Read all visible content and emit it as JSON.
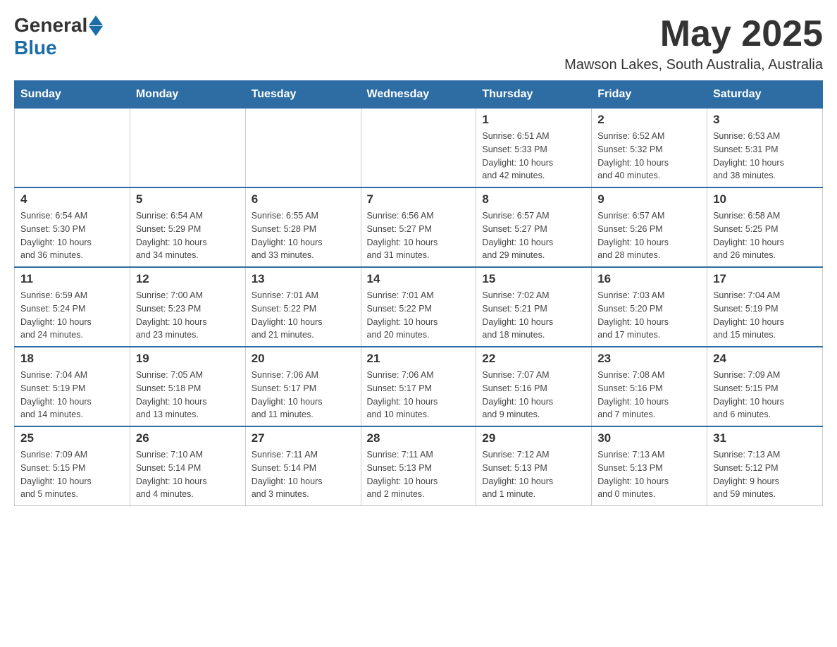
{
  "header": {
    "logo_general": "General",
    "logo_blue": "Blue",
    "month_year": "May 2025",
    "location": "Mawson Lakes, South Australia, Australia"
  },
  "weekdays": [
    "Sunday",
    "Monday",
    "Tuesday",
    "Wednesday",
    "Thursday",
    "Friday",
    "Saturday"
  ],
  "weeks": [
    [
      {
        "day": "",
        "info": ""
      },
      {
        "day": "",
        "info": ""
      },
      {
        "day": "",
        "info": ""
      },
      {
        "day": "",
        "info": ""
      },
      {
        "day": "1",
        "info": "Sunrise: 6:51 AM\nSunset: 5:33 PM\nDaylight: 10 hours\nand 42 minutes."
      },
      {
        "day": "2",
        "info": "Sunrise: 6:52 AM\nSunset: 5:32 PM\nDaylight: 10 hours\nand 40 minutes."
      },
      {
        "day": "3",
        "info": "Sunrise: 6:53 AM\nSunset: 5:31 PM\nDaylight: 10 hours\nand 38 minutes."
      }
    ],
    [
      {
        "day": "4",
        "info": "Sunrise: 6:54 AM\nSunset: 5:30 PM\nDaylight: 10 hours\nand 36 minutes."
      },
      {
        "day": "5",
        "info": "Sunrise: 6:54 AM\nSunset: 5:29 PM\nDaylight: 10 hours\nand 34 minutes."
      },
      {
        "day": "6",
        "info": "Sunrise: 6:55 AM\nSunset: 5:28 PM\nDaylight: 10 hours\nand 33 minutes."
      },
      {
        "day": "7",
        "info": "Sunrise: 6:56 AM\nSunset: 5:27 PM\nDaylight: 10 hours\nand 31 minutes."
      },
      {
        "day": "8",
        "info": "Sunrise: 6:57 AM\nSunset: 5:27 PM\nDaylight: 10 hours\nand 29 minutes."
      },
      {
        "day": "9",
        "info": "Sunrise: 6:57 AM\nSunset: 5:26 PM\nDaylight: 10 hours\nand 28 minutes."
      },
      {
        "day": "10",
        "info": "Sunrise: 6:58 AM\nSunset: 5:25 PM\nDaylight: 10 hours\nand 26 minutes."
      }
    ],
    [
      {
        "day": "11",
        "info": "Sunrise: 6:59 AM\nSunset: 5:24 PM\nDaylight: 10 hours\nand 24 minutes."
      },
      {
        "day": "12",
        "info": "Sunrise: 7:00 AM\nSunset: 5:23 PM\nDaylight: 10 hours\nand 23 minutes."
      },
      {
        "day": "13",
        "info": "Sunrise: 7:01 AM\nSunset: 5:22 PM\nDaylight: 10 hours\nand 21 minutes."
      },
      {
        "day": "14",
        "info": "Sunrise: 7:01 AM\nSunset: 5:22 PM\nDaylight: 10 hours\nand 20 minutes."
      },
      {
        "day": "15",
        "info": "Sunrise: 7:02 AM\nSunset: 5:21 PM\nDaylight: 10 hours\nand 18 minutes."
      },
      {
        "day": "16",
        "info": "Sunrise: 7:03 AM\nSunset: 5:20 PM\nDaylight: 10 hours\nand 17 minutes."
      },
      {
        "day": "17",
        "info": "Sunrise: 7:04 AM\nSunset: 5:19 PM\nDaylight: 10 hours\nand 15 minutes."
      }
    ],
    [
      {
        "day": "18",
        "info": "Sunrise: 7:04 AM\nSunset: 5:19 PM\nDaylight: 10 hours\nand 14 minutes."
      },
      {
        "day": "19",
        "info": "Sunrise: 7:05 AM\nSunset: 5:18 PM\nDaylight: 10 hours\nand 13 minutes."
      },
      {
        "day": "20",
        "info": "Sunrise: 7:06 AM\nSunset: 5:17 PM\nDaylight: 10 hours\nand 11 minutes."
      },
      {
        "day": "21",
        "info": "Sunrise: 7:06 AM\nSunset: 5:17 PM\nDaylight: 10 hours\nand 10 minutes."
      },
      {
        "day": "22",
        "info": "Sunrise: 7:07 AM\nSunset: 5:16 PM\nDaylight: 10 hours\nand 9 minutes."
      },
      {
        "day": "23",
        "info": "Sunrise: 7:08 AM\nSunset: 5:16 PM\nDaylight: 10 hours\nand 7 minutes."
      },
      {
        "day": "24",
        "info": "Sunrise: 7:09 AM\nSunset: 5:15 PM\nDaylight: 10 hours\nand 6 minutes."
      }
    ],
    [
      {
        "day": "25",
        "info": "Sunrise: 7:09 AM\nSunset: 5:15 PM\nDaylight: 10 hours\nand 5 minutes."
      },
      {
        "day": "26",
        "info": "Sunrise: 7:10 AM\nSunset: 5:14 PM\nDaylight: 10 hours\nand 4 minutes."
      },
      {
        "day": "27",
        "info": "Sunrise: 7:11 AM\nSunset: 5:14 PM\nDaylight: 10 hours\nand 3 minutes."
      },
      {
        "day": "28",
        "info": "Sunrise: 7:11 AM\nSunset: 5:13 PM\nDaylight: 10 hours\nand 2 minutes."
      },
      {
        "day": "29",
        "info": "Sunrise: 7:12 AM\nSunset: 5:13 PM\nDaylight: 10 hours\nand 1 minute."
      },
      {
        "day": "30",
        "info": "Sunrise: 7:13 AM\nSunset: 5:13 PM\nDaylight: 10 hours\nand 0 minutes."
      },
      {
        "day": "31",
        "info": "Sunrise: 7:13 AM\nSunset: 5:12 PM\nDaylight: 9 hours\nand 59 minutes."
      }
    ]
  ]
}
